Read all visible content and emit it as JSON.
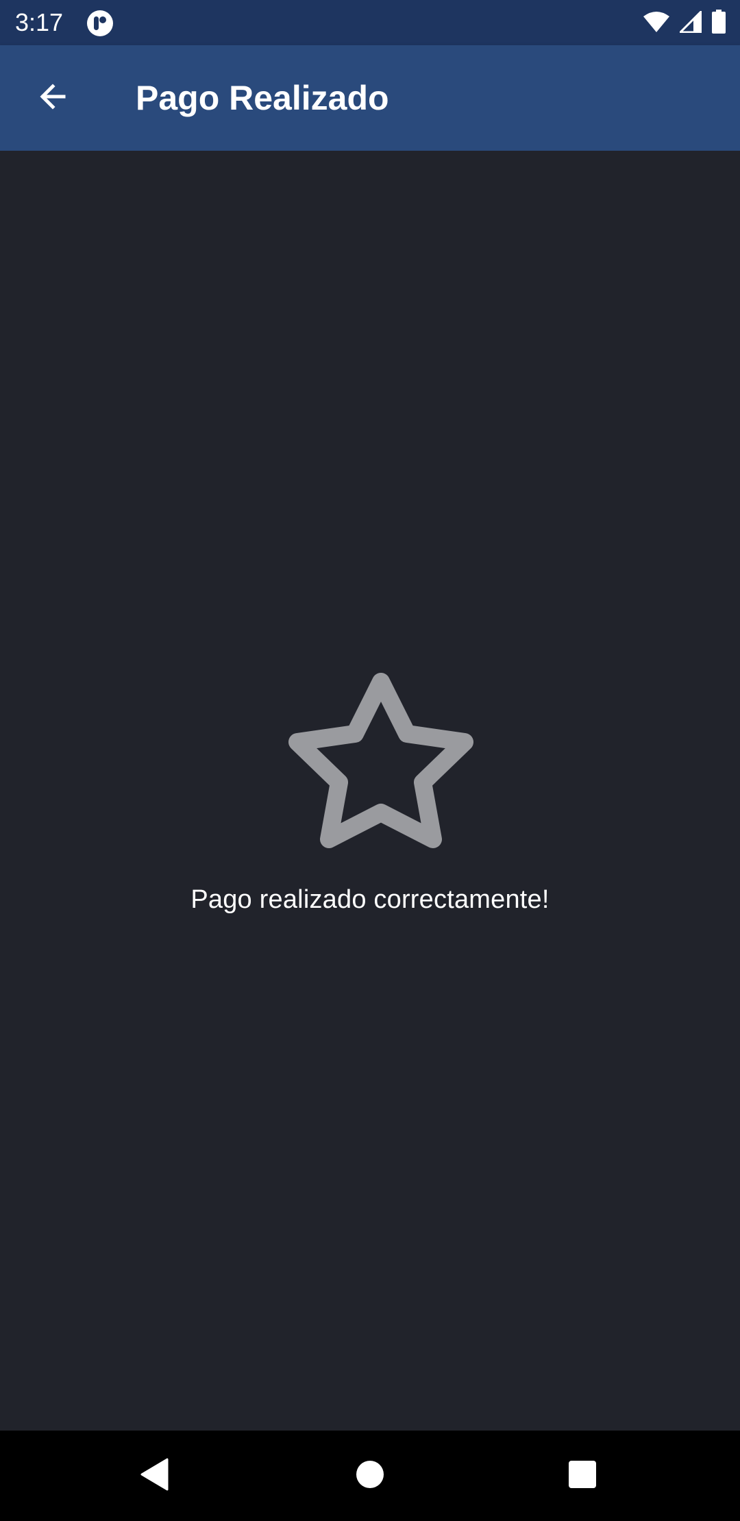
{
  "status_bar": {
    "time": "3:17",
    "icons": [
      "app-notification-icon",
      "wifi-icon",
      "cellular-signal-icon",
      "battery-icon"
    ],
    "background": "#1e3560"
  },
  "app_bar": {
    "title": "Pago Realizado",
    "back_icon": "arrow-left-icon",
    "background": "#2a4a7c"
  },
  "main": {
    "icon": "star-outline-icon",
    "icon_color": "#9a9b9f",
    "message": "Pago realizado correctamente!",
    "background": "#21232b"
  },
  "nav_bar": {
    "buttons": [
      "back-triangle-icon",
      "home-circle-icon",
      "recents-square-icon"
    ],
    "background": "#000000"
  }
}
